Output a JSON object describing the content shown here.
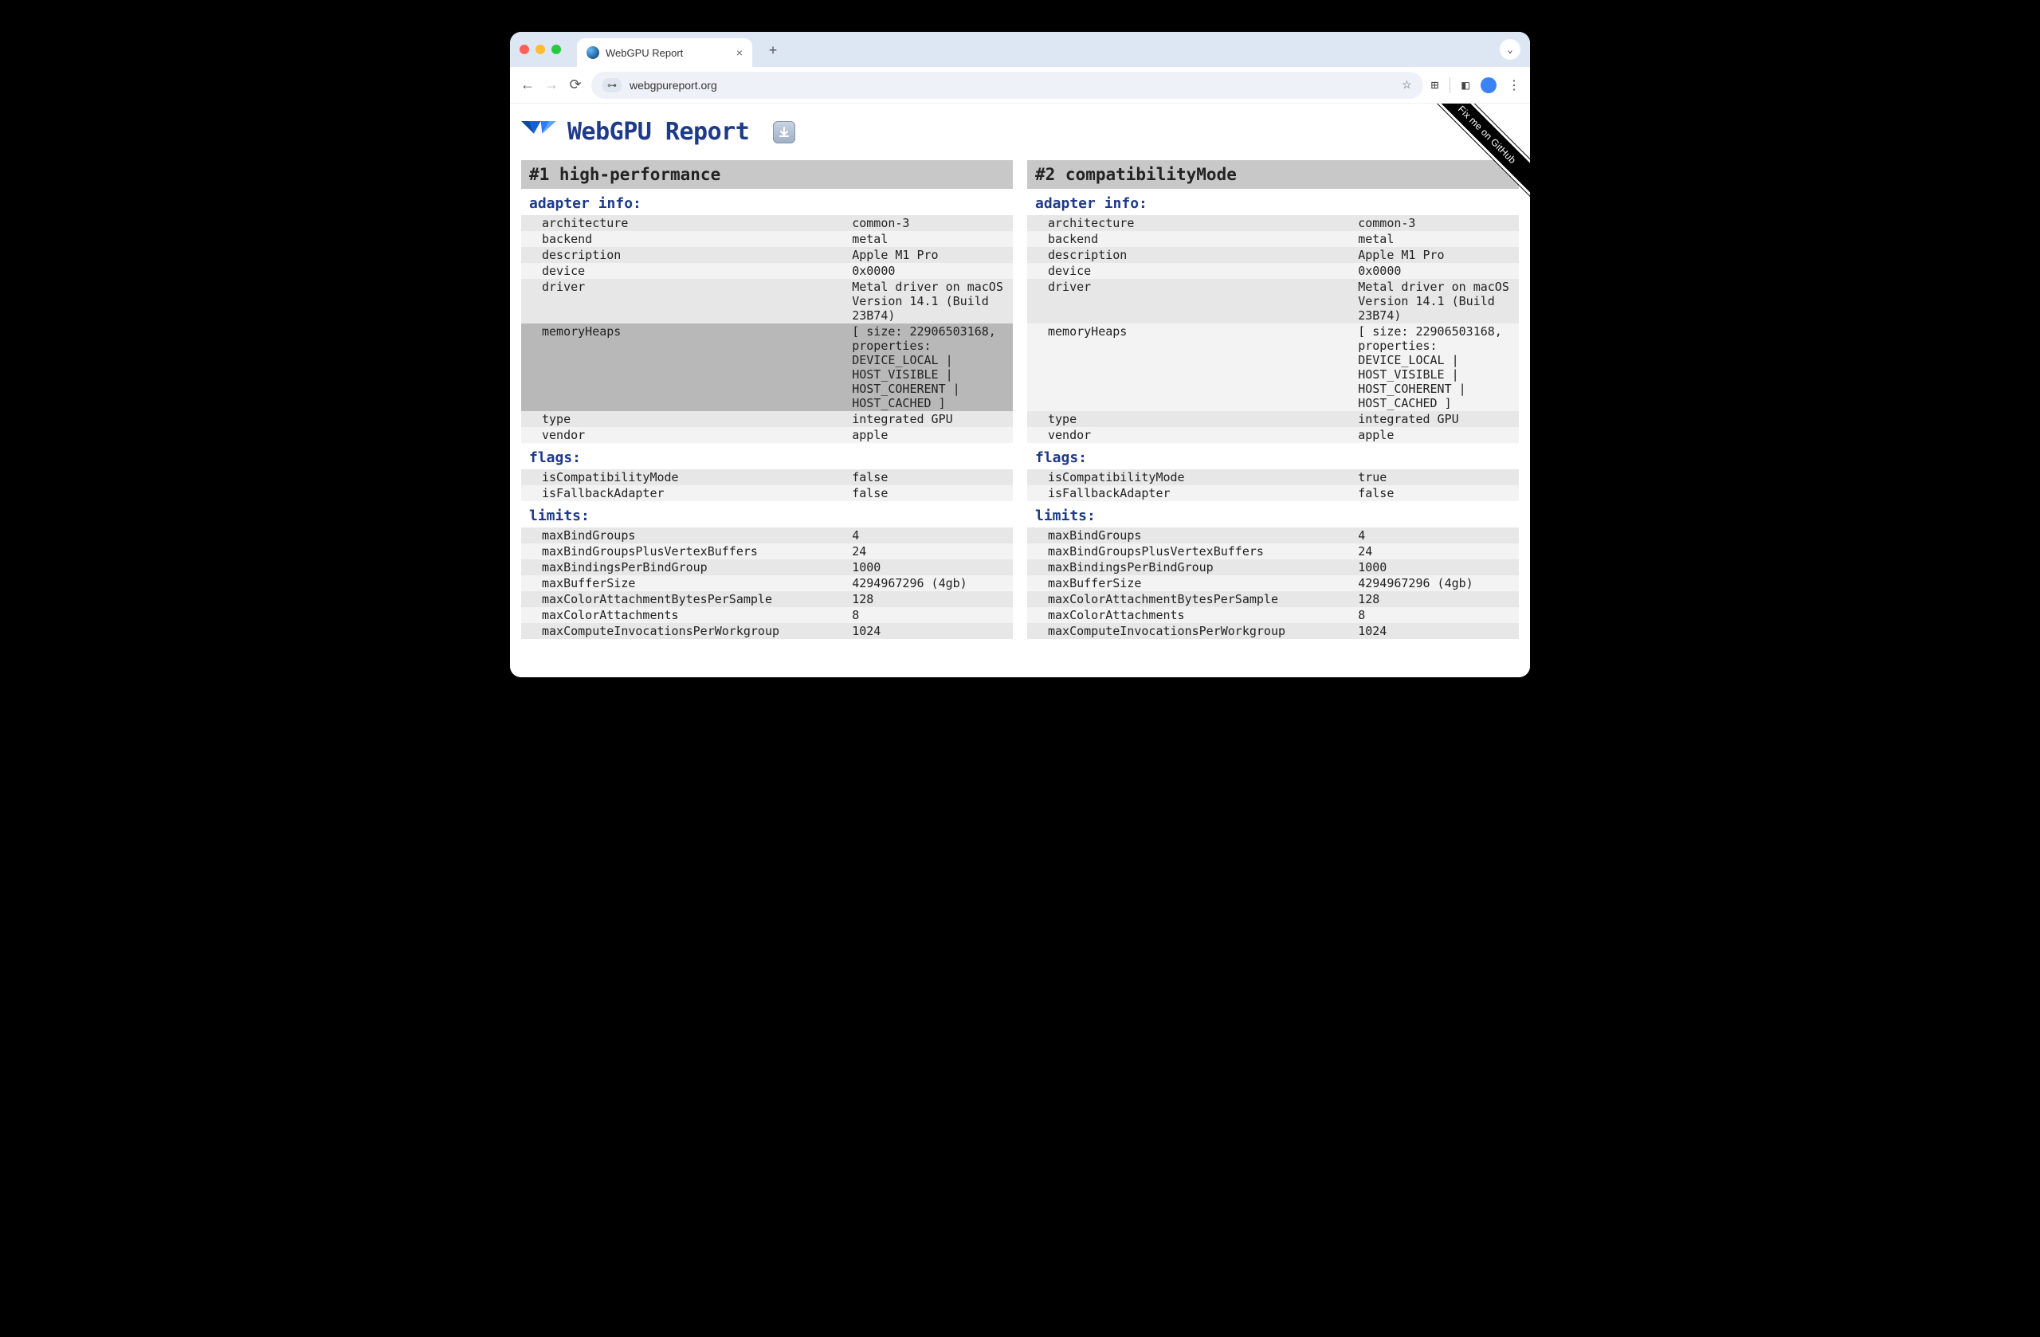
{
  "browser": {
    "tab_title": "WebGPU Report",
    "url": "webgpureport.org"
  },
  "page_title": "WebGPU Report",
  "ribbon": "Fix me on GitHub",
  "columns": [
    {
      "header": "#1 high-performance",
      "sections": [
        {
          "title": "adapter info:",
          "rows": [
            {
              "k": "architecture",
              "v": "common-3"
            },
            {
              "k": "backend",
              "v": "metal"
            },
            {
              "k": "description",
              "v": "Apple M1 Pro"
            },
            {
              "k": "device",
              "v": "0x0000"
            },
            {
              "k": "driver",
              "v": "Metal driver on macOS Version 14.1 (Build 23B74)"
            },
            {
              "k": "memoryHeaps",
              "v": "[ size: 22906503168, properties: DEVICE_LOCAL | HOST_VISIBLE | HOST_COHERENT | HOST_CACHED ]",
              "highlight": true
            },
            {
              "k": "type",
              "v": "integrated GPU"
            },
            {
              "k": "vendor",
              "v": "apple"
            }
          ]
        },
        {
          "title": "flags:",
          "rows": [
            {
              "k": "isCompatibilityMode",
              "v": "false"
            },
            {
              "k": "isFallbackAdapter",
              "v": "false"
            }
          ]
        },
        {
          "title": "limits:",
          "rows": [
            {
              "k": "maxBindGroups",
              "v": "4"
            },
            {
              "k": "maxBindGroupsPlusVertexBuffers",
              "v": "24"
            },
            {
              "k": "maxBindingsPerBindGroup",
              "v": "1000"
            },
            {
              "k": "maxBufferSize",
              "v": "4294967296 (4gb)",
              "pink": true
            },
            {
              "k": "maxColorAttachmentBytesPerSample",
              "v": "128",
              "pink": true
            },
            {
              "k": "maxColorAttachments",
              "v": "8"
            },
            {
              "k": "maxComputeInvocationsPerWorkgroup",
              "v": "1024",
              "pink": true,
              "partial": true
            }
          ]
        }
      ]
    },
    {
      "header": "#2 compatibilityMode",
      "sections": [
        {
          "title": "adapter info:",
          "rows": [
            {
              "k": "architecture",
              "v": "common-3"
            },
            {
              "k": "backend",
              "v": "metal"
            },
            {
              "k": "description",
              "v": "Apple M1 Pro"
            },
            {
              "k": "device",
              "v": "0x0000"
            },
            {
              "k": "driver",
              "v": "Metal driver on macOS Version 14.1 (Build 23B74)"
            },
            {
              "k": "memoryHeaps",
              "v": "[ size: 22906503168, properties: DEVICE_LOCAL | HOST_VISIBLE | HOST_COHERENT | HOST_CACHED ]"
            },
            {
              "k": "type",
              "v": "integrated GPU"
            },
            {
              "k": "vendor",
              "v": "apple"
            }
          ]
        },
        {
          "title": "flags:",
          "rows": [
            {
              "k": "isCompatibilityMode",
              "v": "true"
            },
            {
              "k": "isFallbackAdapter",
              "v": "false"
            }
          ]
        },
        {
          "title": "limits:",
          "rows": [
            {
              "k": "maxBindGroups",
              "v": "4"
            },
            {
              "k": "maxBindGroupsPlusVertexBuffers",
              "v": "24"
            },
            {
              "k": "maxBindingsPerBindGroup",
              "v": "1000"
            },
            {
              "k": "maxBufferSize",
              "v": "4294967296 (4gb)",
              "pink": true
            },
            {
              "k": "maxColorAttachmentBytesPerSample",
              "v": "128",
              "pink": true
            },
            {
              "k": "maxColorAttachments",
              "v": "8"
            },
            {
              "k": "maxComputeInvocationsPerWorkgroup",
              "v": "1024",
              "pink": true,
              "partial": true
            }
          ]
        }
      ]
    }
  ]
}
